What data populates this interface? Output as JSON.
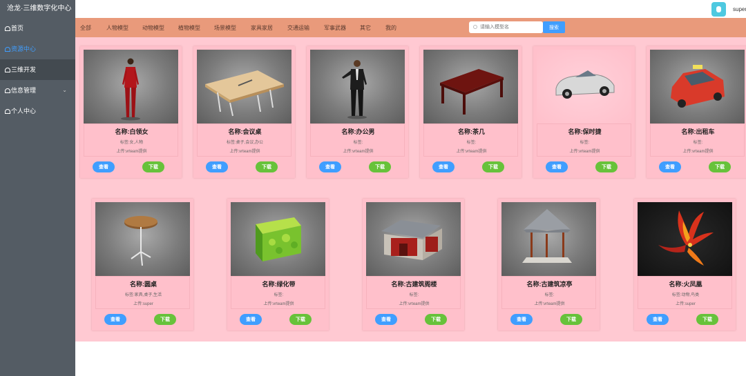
{
  "sidebar": {
    "brand": "沧龙·三维数字化中心",
    "items": [
      {
        "label": "首页"
      },
      {
        "label": "资源中心"
      },
      {
        "label": "三维开发"
      },
      {
        "label": "信息管理"
      },
      {
        "label": "个人中心"
      }
    ]
  },
  "header": {
    "username": "super"
  },
  "categories": [
    "全部",
    "人物模型",
    "动物模型",
    "植物模型",
    "场景模型",
    "家具家居",
    "交通运输",
    "军事武器",
    "其它",
    "我的"
  ],
  "search": {
    "placeholder": "请输入模型名",
    "button": "搜索"
  },
  "buttons": {
    "view": "查看",
    "download": "下载"
  },
  "cards": [
    {
      "name": "名称:白领女",
      "tags": "标签:女,人物",
      "uploader": "上传:vrteam提供",
      "icon": "woman-model-icon"
    },
    {
      "name": "名称:会议桌",
      "tags": "标签:桌子,会议,办公",
      "uploader": "上传:vrteam提供",
      "icon": "table-model-icon"
    },
    {
      "name": "名称:办公男",
      "tags": "标签:",
      "uploader": "上传:vrteam提供",
      "icon": "man-model-icon"
    },
    {
      "name": "名称:茶几",
      "tags": "标签:",
      "uploader": "上传:vrteam提供",
      "icon": "tea-table-model-icon"
    },
    {
      "name": "名称:保时捷",
      "tags": "标签:",
      "uploader": "上传:vrteam提供",
      "icon": "car-model-icon"
    },
    {
      "name": "名称:出租车",
      "tags": "标签:",
      "uploader": "上传:vrteam提供",
      "icon": "taxi-model-icon"
    },
    {
      "name": "名称:圆桌",
      "tags": "标签:家具,桌子,生活",
      "uploader": "上传:super",
      "icon": "round-table-model-icon"
    },
    {
      "name": "名称:绿化带",
      "tags": "标签:",
      "uploader": "上传:vrteam提供",
      "icon": "hedge-model-icon"
    },
    {
      "name": "名称:古建筑阁楼",
      "tags": "标签:",
      "uploader": "上传:vrteam提供",
      "icon": "pavilion-building-model-icon"
    },
    {
      "name": "名称:古建筑凉亭",
      "tags": "标签:",
      "uploader": "上传:vrteam提供",
      "icon": "gazebo-model-icon"
    },
    {
      "name": "名称:火凤凰",
      "tags": "标签:动物,鸟类",
      "uploader": "上传:super",
      "icon": "phoenix-model-icon"
    }
  ]
}
